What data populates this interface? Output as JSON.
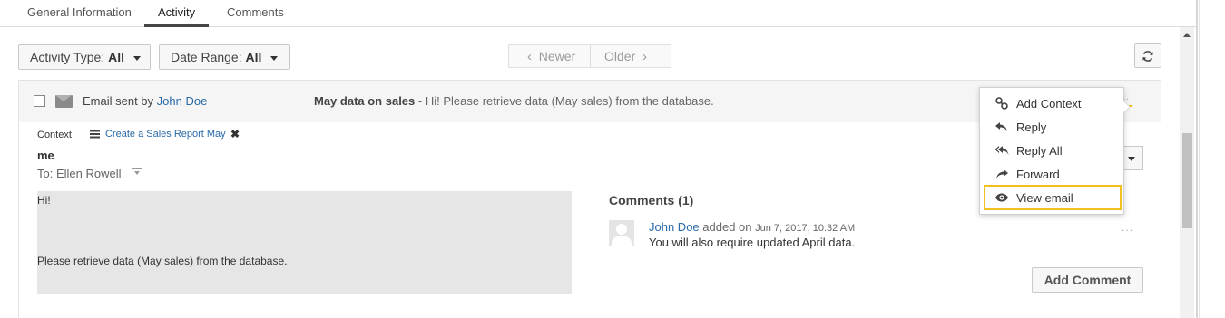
{
  "tabs": [
    {
      "label": "General Information",
      "active": false
    },
    {
      "label": "Activity",
      "active": true
    },
    {
      "label": "Comments",
      "active": false
    }
  ],
  "toolbar": {
    "activity_type_label": "Activity Type:",
    "activity_type_value": "All",
    "date_range_label": "Date Range:",
    "date_range_value": "All",
    "newer": "Newer",
    "older": "Older"
  },
  "activity": {
    "head_prefix": "Email sent by",
    "sender": "John Doe",
    "subject": "May data on sales",
    "subject_preview": " - Hi! Please retrieve data (May sales) from the database.",
    "context_label": "Context",
    "context_link": "Create a Sales Report May",
    "from": "me",
    "to_label": "To:",
    "to_name": "Ellen Rowell",
    "body_line1": "Hi!",
    "body_line2": "Please retrieve data (May sales) from the database."
  },
  "comments": {
    "title": "Comments (1)",
    "author": "John Doe",
    "added_on": "added on",
    "timestamp": "Jun 7, 2017, 10:32 AM",
    "text": "You will also require updated April data.",
    "more": "...",
    "add_button": "Add Comment"
  },
  "menu": {
    "items": [
      {
        "label": "Add Context",
        "icon": "link-icon"
      },
      {
        "label": "Reply",
        "icon": "reply-icon"
      },
      {
        "label": "Reply All",
        "icon": "reply-all-icon"
      },
      {
        "label": "Forward",
        "icon": "forward-icon"
      },
      {
        "label": "View email",
        "icon": "eye-icon",
        "highlighted": true
      }
    ]
  },
  "colors": {
    "link": "#2a6aa8",
    "highlight": "#f0c020",
    "email_body_bg": "#e6e6e6"
  }
}
